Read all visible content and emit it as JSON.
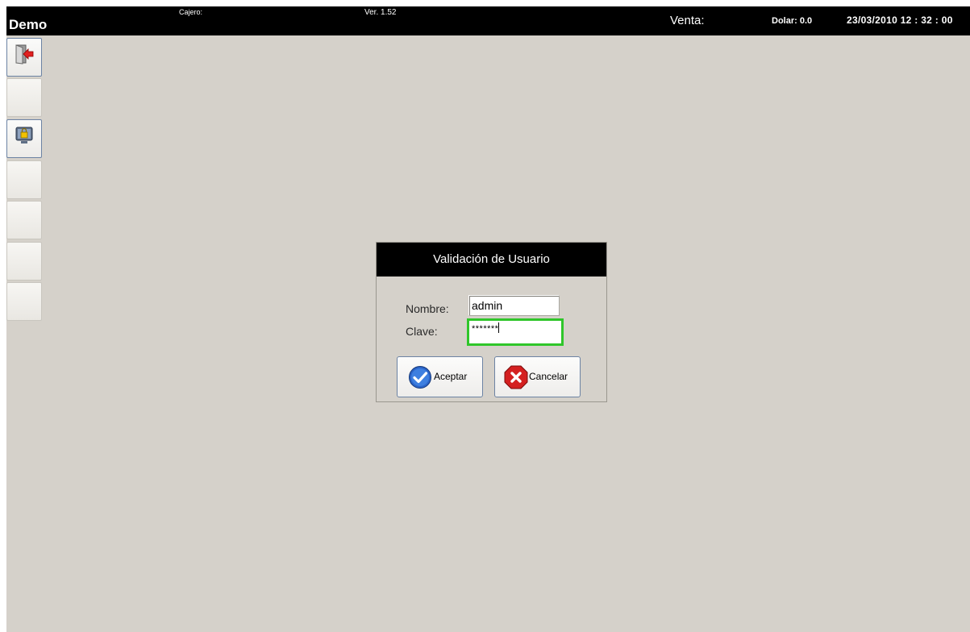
{
  "header": {
    "app_name": "Demo",
    "cashier_label": "Cajero:",
    "version": "Ver. 1.52",
    "sale_label": "Venta:",
    "dollar": "Dolar: 0.0",
    "datetime": "23/03/2010 12 : 32 : 00"
  },
  "sidebar": {
    "buttons": [
      {
        "icon": "exit-door-icon"
      },
      {
        "icon": ""
      },
      {
        "icon": "lock-screen-icon"
      },
      {
        "icon": ""
      },
      {
        "icon": ""
      },
      {
        "icon": ""
      },
      {
        "icon": ""
      }
    ]
  },
  "dialog": {
    "title": "Validación de Usuario",
    "name_label": "Nombre:",
    "name_value": "admin",
    "password_label": "Clave:",
    "password_value": "*******",
    "accept_label": "Aceptar",
    "cancel_label": "Cancelar"
  },
  "colors": {
    "background": "#d5d1ca",
    "bar": "#000000",
    "focus_border": "#2fc62a",
    "button_border": "#6c83a4"
  }
}
